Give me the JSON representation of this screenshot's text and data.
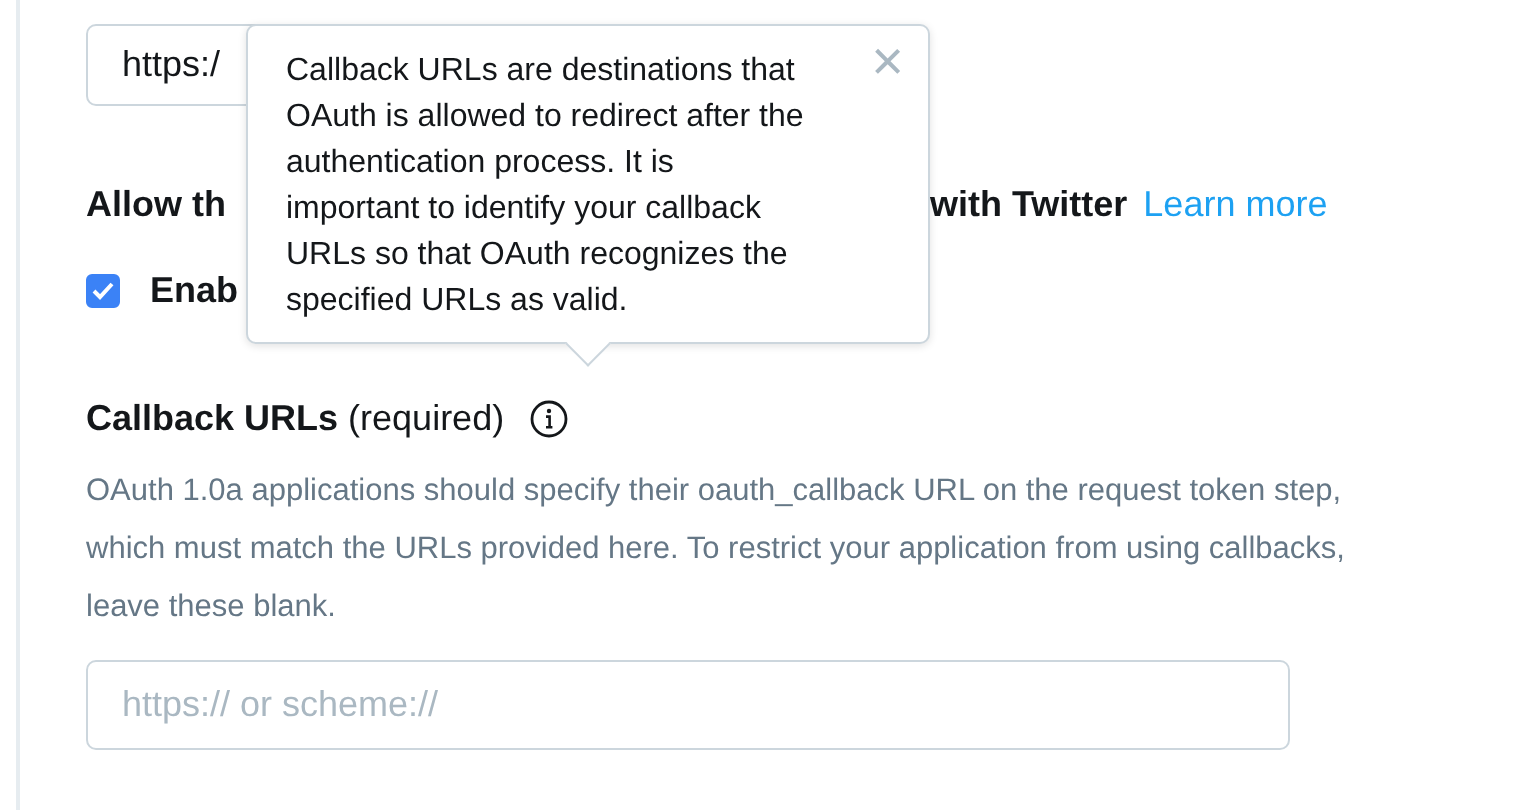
{
  "top_field": {
    "value": "https:/"
  },
  "sign_in_section": {
    "heading_start": "Allow th",
    "heading_end": "with Twitter",
    "link": "Learn more",
    "checkbox": {
      "label": "Enab",
      "checked": true
    }
  },
  "callback_section": {
    "title": "Callback URLs",
    "suffix": "(required)",
    "description": "OAuth 1.0a applications should specify their oauth_callback URL on the request token step, which must match the URLs provided here. To restrict your application from using callbacks, leave these blank.",
    "field": {
      "placeholder": "https:// or scheme://"
    }
  },
  "popover": {
    "text": "Callback URLs are destinations that OAuth is allowed to redirect after the authentication process. It is important to identify your callback URLs so that OAuth recognizes the specified URLs as valid.",
    "close": "×"
  }
}
